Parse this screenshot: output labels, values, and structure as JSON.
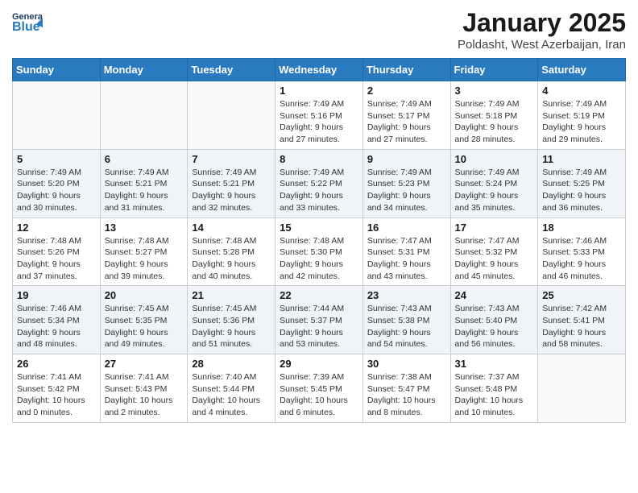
{
  "header": {
    "logo_general": "General",
    "logo_blue": "Blue",
    "month_title": "January 2025",
    "location": "Poldasht, West Azerbaijan, Iran"
  },
  "days_of_week": [
    "Sunday",
    "Monday",
    "Tuesday",
    "Wednesday",
    "Thursday",
    "Friday",
    "Saturday"
  ],
  "weeks": [
    {
      "cells": [
        {
          "day": null,
          "info": null
        },
        {
          "day": null,
          "info": null
        },
        {
          "day": null,
          "info": null
        },
        {
          "day": "1",
          "info": "Sunrise: 7:49 AM\nSunset: 5:16 PM\nDaylight: 9 hours\nand 27 minutes."
        },
        {
          "day": "2",
          "info": "Sunrise: 7:49 AM\nSunset: 5:17 PM\nDaylight: 9 hours\nand 27 minutes."
        },
        {
          "day": "3",
          "info": "Sunrise: 7:49 AM\nSunset: 5:18 PM\nDaylight: 9 hours\nand 28 minutes."
        },
        {
          "day": "4",
          "info": "Sunrise: 7:49 AM\nSunset: 5:19 PM\nDaylight: 9 hours\nand 29 minutes."
        }
      ]
    },
    {
      "cells": [
        {
          "day": "5",
          "info": "Sunrise: 7:49 AM\nSunset: 5:20 PM\nDaylight: 9 hours\nand 30 minutes."
        },
        {
          "day": "6",
          "info": "Sunrise: 7:49 AM\nSunset: 5:21 PM\nDaylight: 9 hours\nand 31 minutes."
        },
        {
          "day": "7",
          "info": "Sunrise: 7:49 AM\nSunset: 5:21 PM\nDaylight: 9 hours\nand 32 minutes."
        },
        {
          "day": "8",
          "info": "Sunrise: 7:49 AM\nSunset: 5:22 PM\nDaylight: 9 hours\nand 33 minutes."
        },
        {
          "day": "9",
          "info": "Sunrise: 7:49 AM\nSunset: 5:23 PM\nDaylight: 9 hours\nand 34 minutes."
        },
        {
          "day": "10",
          "info": "Sunrise: 7:49 AM\nSunset: 5:24 PM\nDaylight: 9 hours\nand 35 minutes."
        },
        {
          "day": "11",
          "info": "Sunrise: 7:49 AM\nSunset: 5:25 PM\nDaylight: 9 hours\nand 36 minutes."
        }
      ]
    },
    {
      "cells": [
        {
          "day": "12",
          "info": "Sunrise: 7:48 AM\nSunset: 5:26 PM\nDaylight: 9 hours\nand 37 minutes."
        },
        {
          "day": "13",
          "info": "Sunrise: 7:48 AM\nSunset: 5:27 PM\nDaylight: 9 hours\nand 39 minutes."
        },
        {
          "day": "14",
          "info": "Sunrise: 7:48 AM\nSunset: 5:28 PM\nDaylight: 9 hours\nand 40 minutes."
        },
        {
          "day": "15",
          "info": "Sunrise: 7:48 AM\nSunset: 5:30 PM\nDaylight: 9 hours\nand 42 minutes."
        },
        {
          "day": "16",
          "info": "Sunrise: 7:47 AM\nSunset: 5:31 PM\nDaylight: 9 hours\nand 43 minutes."
        },
        {
          "day": "17",
          "info": "Sunrise: 7:47 AM\nSunset: 5:32 PM\nDaylight: 9 hours\nand 45 minutes."
        },
        {
          "day": "18",
          "info": "Sunrise: 7:46 AM\nSunset: 5:33 PM\nDaylight: 9 hours\nand 46 minutes."
        }
      ]
    },
    {
      "cells": [
        {
          "day": "19",
          "info": "Sunrise: 7:46 AM\nSunset: 5:34 PM\nDaylight: 9 hours\nand 48 minutes."
        },
        {
          "day": "20",
          "info": "Sunrise: 7:45 AM\nSunset: 5:35 PM\nDaylight: 9 hours\nand 49 minutes."
        },
        {
          "day": "21",
          "info": "Sunrise: 7:45 AM\nSunset: 5:36 PM\nDaylight: 9 hours\nand 51 minutes."
        },
        {
          "day": "22",
          "info": "Sunrise: 7:44 AM\nSunset: 5:37 PM\nDaylight: 9 hours\nand 53 minutes."
        },
        {
          "day": "23",
          "info": "Sunrise: 7:43 AM\nSunset: 5:38 PM\nDaylight: 9 hours\nand 54 minutes."
        },
        {
          "day": "24",
          "info": "Sunrise: 7:43 AM\nSunset: 5:40 PM\nDaylight: 9 hours\nand 56 minutes."
        },
        {
          "day": "25",
          "info": "Sunrise: 7:42 AM\nSunset: 5:41 PM\nDaylight: 9 hours\nand 58 minutes."
        }
      ]
    },
    {
      "cells": [
        {
          "day": "26",
          "info": "Sunrise: 7:41 AM\nSunset: 5:42 PM\nDaylight: 10 hours\nand 0 minutes."
        },
        {
          "day": "27",
          "info": "Sunrise: 7:41 AM\nSunset: 5:43 PM\nDaylight: 10 hours\nand 2 minutes."
        },
        {
          "day": "28",
          "info": "Sunrise: 7:40 AM\nSunset: 5:44 PM\nDaylight: 10 hours\nand 4 minutes."
        },
        {
          "day": "29",
          "info": "Sunrise: 7:39 AM\nSunset: 5:45 PM\nDaylight: 10 hours\nand 6 minutes."
        },
        {
          "day": "30",
          "info": "Sunrise: 7:38 AM\nSunset: 5:47 PM\nDaylight: 10 hours\nand 8 minutes."
        },
        {
          "day": "31",
          "info": "Sunrise: 7:37 AM\nSunset: 5:48 PM\nDaylight: 10 hours\nand 10 minutes."
        },
        {
          "day": null,
          "info": null
        }
      ]
    }
  ]
}
